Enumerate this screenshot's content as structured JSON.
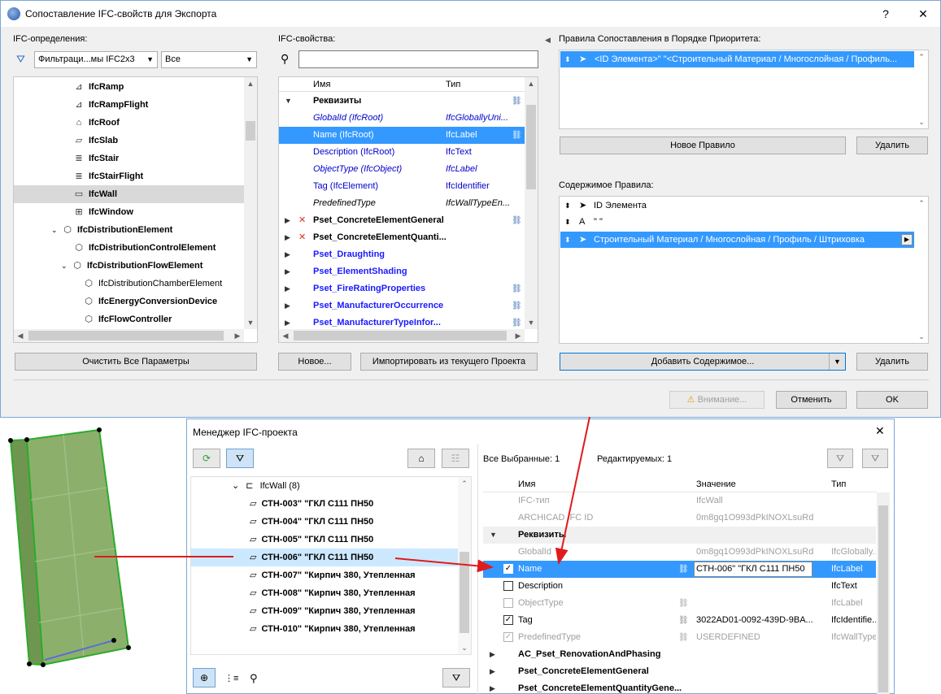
{
  "main_dialog": {
    "title": "Сопоставление IFC-свойств для Экспорта",
    "help": "?",
    "close": "✕",
    "ifc_definitions_label": "IFC-определения:",
    "filter_combo": "Фильтраци...мы IFC2x3",
    "all_combo": "Все",
    "tree": [
      {
        "label": "IfcRamp",
        "icon": "⊿"
      },
      {
        "label": "IfcRampFlight",
        "icon": "⊿"
      },
      {
        "label": "IfcRoof",
        "icon": "⌂"
      },
      {
        "label": "IfcSlab",
        "icon": "▱"
      },
      {
        "label": "IfcStair",
        "icon": "≣"
      },
      {
        "label": "IfcStairFlight",
        "icon": "≣"
      },
      {
        "label": "IfcWall",
        "icon": "▭"
      },
      {
        "label": "IfcWindow",
        "icon": "⊞"
      },
      {
        "label": "IfcDistributionElement",
        "icon": "⬡"
      },
      {
        "label": "IfcDistributionControlElement",
        "icon": "⬡"
      },
      {
        "label": "IfcDistributionFlowElement",
        "icon": "⬡"
      },
      {
        "label": "IfcDistributionChamberElement",
        "icon": "⬡"
      },
      {
        "label": "IfcEnergyConversionDevice",
        "icon": "⬡"
      },
      {
        "label": "IfcFlowController",
        "icon": "⬡"
      }
    ],
    "clear_all_button": "Очистить Все Параметры",
    "ifc_properties_label": "IFC-свойства:",
    "search_value": "",
    "col_name": "Имя",
    "col_type": "Тип",
    "properties": [
      {
        "name": "Реквизиты",
        "type": ""
      },
      {
        "name": "GlobalId (IfcRoot)",
        "type": "IfcGloballyUni..."
      },
      {
        "name": "Name (IfcRoot)",
        "type": "IfcLabel"
      },
      {
        "name": "Description (IfcRoot)",
        "type": "IfcText"
      },
      {
        "name": "ObjectType (IfcObject)",
        "type": "IfcLabel"
      },
      {
        "name": "Tag (IfcElement)",
        "type": "IfcIdentifier"
      },
      {
        "name": "PredefinedType",
        "type": "IfcWallTypeEn..."
      },
      {
        "name": "Pset_ConcreteElementGeneral",
        "type": ""
      },
      {
        "name": "Pset_ConcreteElementQuanti...",
        "type": ""
      },
      {
        "name": "Pset_Draughting",
        "type": ""
      },
      {
        "name": "Pset_ElementShading",
        "type": ""
      },
      {
        "name": "Pset_FireRatingProperties",
        "type": ""
      },
      {
        "name": "Pset_ManufacturerOccurrence",
        "type": ""
      },
      {
        "name": "Pset_ManufacturerTypeInfor...",
        "type": ""
      }
    ],
    "new_button": "Новое...",
    "import_button": "Импортировать из текущего Проекта",
    "rules_label": "Правила Сопоставления в Порядке Приоритета:",
    "rule_1": "<ID Элемента>\" \"<Строительный Материал / Многослойная / Профиль...",
    "new_rule_button": "Новое Правило",
    "delete_rule_button": "Удалить",
    "rule_content_label": "Содержимое Правила:",
    "rule_content": [
      {
        "label": "ID Элемента"
      },
      {
        "label": "\" \""
      },
      {
        "label": "Строительный Материал / Многослойная / Профиль / Штриховка"
      }
    ],
    "add_content_button": "Добавить Содержимое...",
    "delete_content_button": "Удалить",
    "warning_button": "Внимание...",
    "cancel_button": "Отменить",
    "ok_button": "OK"
  },
  "project_manager": {
    "title": "Менеджер IFC-проекта",
    "close": "✕",
    "tree_root": "IfcWall (8)",
    "walls": [
      "СТН-003\" \"ГКЛ С111 ПН50",
      "СТН-004\" \"ГКЛ С111 ПН50",
      "СТН-005\" \"ГКЛ С111 ПН50",
      "СТН-006\" \"ГКЛ С111 ПН50",
      "СТН-007\" \"Кирпич 380, Утепленная",
      "СТН-008\" \"Кирпич 380, Утепленная",
      "СТН-009\" \"Кирпич 380, Утепленная",
      "СТН-010\" \"Кирпич 380, Утепленная"
    ],
    "all_selected": "Все Выбранные: 1",
    "editable": "Редактируемых: 1",
    "col_name": "Имя",
    "col_value": "Значение",
    "col_type": "Тип",
    "rows": [
      {
        "name": "IFC-тип",
        "value": "IfcWall",
        "type": ""
      },
      {
        "name": "ARCHICAD IFC ID",
        "value": "0m8gq1O993dPkINOXLsuRd",
        "type": ""
      },
      {
        "name": "Реквизиты",
        "value": "",
        "type": ""
      },
      {
        "name": "GlobalId",
        "value": "0m8gq1O993dPkINOXLsuRd",
        "type": "IfcGlobally..."
      },
      {
        "name": "Name",
        "value": "СТН-006\" \"ГКЛ С111 ПН50",
        "type": "IfcLabel"
      },
      {
        "name": "Description",
        "value": "",
        "type": "IfcText"
      },
      {
        "name": "ObjectType",
        "value": "",
        "type": "IfcLabel"
      },
      {
        "name": "Tag",
        "value": "3022AD01-0092-439D-9BA...",
        "type": "IfcIdentifie..."
      },
      {
        "name": "PredefinedType",
        "value": "USERDEFINED",
        "type": "IfcWallType..."
      },
      {
        "name": "AC_Pset_RenovationAndPhasing",
        "value": "",
        "type": ""
      },
      {
        "name": "Pset_ConcreteElementGeneral",
        "value": "",
        "type": ""
      },
      {
        "name": "Pset_ConcreteElementQuantityGene...",
        "value": "",
        "type": ""
      }
    ]
  },
  "colors": {
    "selection": "#3399ff",
    "arrow": "#e01b1b",
    "wall_green": "#7aa25a"
  }
}
